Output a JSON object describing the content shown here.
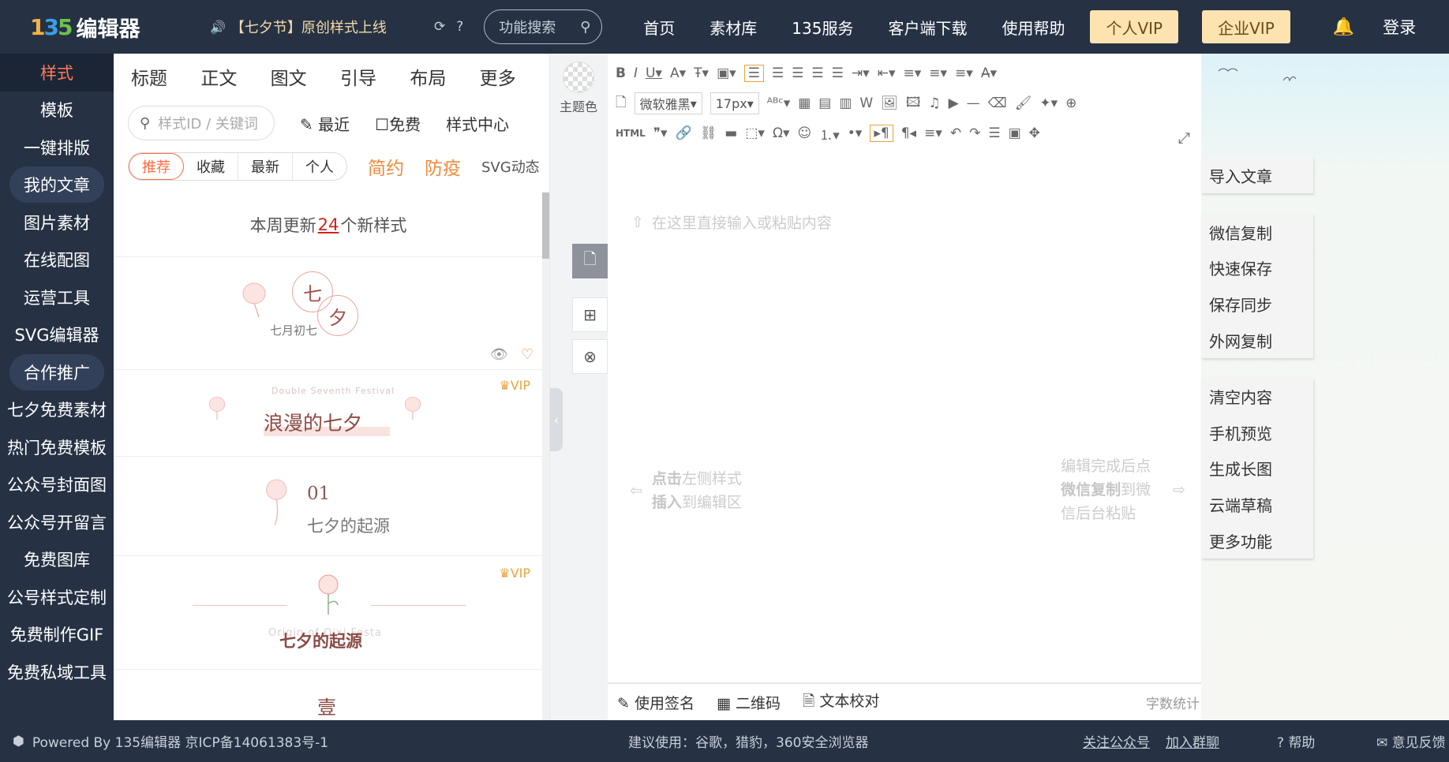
{
  "header": {
    "logo_mark": "135",
    "logo_text": "编辑器",
    "announcement": "【七夕节】原创样式上线",
    "search_placeholder": "功能搜索",
    "nav": [
      "首页",
      "素材库",
      "135服务",
      "客户端下载",
      "使用帮助"
    ],
    "vip_personal": "个人VIP",
    "vip_enterprise": "企业VIP",
    "login": "登录"
  },
  "sidebar": {
    "items": [
      "样式",
      "模板",
      "一键排版",
      "我的文章",
      "图片素材",
      "在线配图",
      "运营工具",
      "SVG编辑器",
      "合作推广",
      "七夕免费素材",
      "热门免费模板",
      "公众号封面图",
      "公众号开留言",
      "免费图库",
      "公号样式定制",
      "免费制作GIF",
      "免费私域工具"
    ]
  },
  "panel": {
    "tabs": [
      "标题",
      "正文",
      "图文",
      "引导",
      "布局",
      "更多"
    ],
    "search_placeholder": "样式ID / 关键词",
    "recent": "最近",
    "free": "免费",
    "style_center": "样式中心",
    "segments": [
      "推荐",
      "收藏",
      "最新",
      "个人"
    ],
    "tag_simple": "简约",
    "tag_epidemic": "防疫",
    "tag_svg": "SVG动态",
    "notice_prefix": "本周更新",
    "notice_count": "24",
    "notice_suffix": "个新样式",
    "vip_label": "VIP",
    "cards": {
      "c1_char1": "七",
      "c1_char2": "夕",
      "c1_sub": "七月初七",
      "c2_sub": "Double Seventh Festival",
      "c2_title": "浪漫的七夕",
      "c3_num": "01",
      "c3_title": "七夕的起源",
      "c4_sub": "Origin of Qixi Festa",
      "c4_title": "七夕的起源",
      "c5_title": "壹"
    }
  },
  "strip": {
    "theme_label": "主题色"
  },
  "editor": {
    "font_family": "微软雅黑",
    "font_size": "17px",
    "html_label": "HTML",
    "placeholder": "在这里直接输入或粘贴内容",
    "hint_left_1": "点击",
    "hint_left_2": "左侧样式",
    "hint_left_3": "插入",
    "hint_left_4": "到编辑区",
    "hint_right_1": "编辑完成后点",
    "hint_right_2": "微信复制",
    "hint_right_3": "到微信后台粘贴",
    "footer_signature": "使用签名",
    "footer_qrcode": "二维码",
    "footer_proofread": "文本校对",
    "footer_wordcount": "字数统计"
  },
  "right": {
    "buttons": [
      "导入文章",
      "微信复制",
      "快速保存",
      "保存同步",
      "外网复制",
      "清空内容",
      "手机预览",
      "生成长图",
      "云端草稿",
      "更多功能"
    ]
  },
  "footer": {
    "powered": "Powered By 135编辑器  京ICP备14061383号-1",
    "browser": "建议使用：谷歌，猎豹，360安全浏览器",
    "follow": "关注公众号",
    "join": "加入群聊",
    "help": "帮助",
    "feedback": "意见反馈"
  },
  "colors": {
    "topbar": "#263244",
    "accent": "#ff6a3d",
    "vip": "#fde3b0"
  }
}
